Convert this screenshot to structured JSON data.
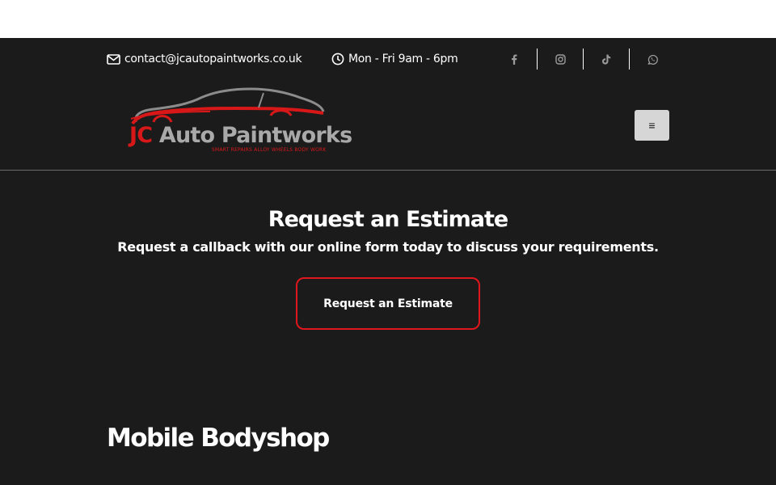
{
  "topbar": {
    "email": "contact@jcautopaintworks.co.uk",
    "hours": "Mon - Fri 9am - 6pm",
    "social": [
      {
        "name": "facebook-icon"
      },
      {
        "name": "instagram-icon"
      },
      {
        "name": "tiktok-icon"
      },
      {
        "name": "whatsapp-icon"
      }
    ]
  },
  "logo": {
    "initials": "JC",
    "name": "Auto Paintworks",
    "tagline": "SMART REPAIRS   ALLOY WHEELS   BODY WORK"
  },
  "menu": {
    "icon": "hamburger-icon",
    "glyph": "≡"
  },
  "hero": {
    "title": "Request an Estimate",
    "subtitle": "Request a callback with our online form today to discuss your requirements.",
    "button_label": "Request an Estimate"
  },
  "section": {
    "title": "Mobile Bodyshop"
  },
  "colors": {
    "background": "#1b1b1c",
    "accent": "#e0161d",
    "logo_grey": "#a9a9a9"
  }
}
